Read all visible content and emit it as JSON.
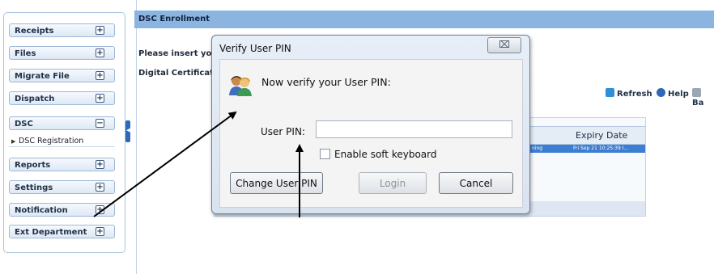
{
  "sidebar": {
    "items": [
      {
        "label": "Receipts",
        "toggle": "+"
      },
      {
        "label": "Files",
        "toggle": "+"
      },
      {
        "label": "Migrate File",
        "toggle": "+"
      },
      {
        "label": "Dispatch",
        "toggle": "+"
      },
      {
        "label": "DSC",
        "toggle": "−"
      },
      {
        "label": "Reports",
        "toggle": "+"
      },
      {
        "label": "Settings",
        "toggle": "+"
      },
      {
        "label": "Notification",
        "toggle": "+"
      },
      {
        "label": "Ext Department",
        "toggle": "+"
      }
    ],
    "sub_items": [
      {
        "label": "DSC Registration"
      }
    ]
  },
  "page": {
    "title": "DSC Enrollment",
    "instruction": "Please insert you",
    "certificate_label": "Digital Certificate"
  },
  "toolbar": {
    "refresh": "Refresh",
    "help": "Help",
    "back": "Ba"
  },
  "grid": {
    "column_expiry": "Expiry Date",
    "row": {
      "status": "ning",
      "expiry": "Fri Sep 21 10:25:39 I..."
    }
  },
  "dialog": {
    "title": "Verify User PIN",
    "close": "⌧",
    "prompt": "Now verify your User PIN:",
    "pin_label": "User PIN:",
    "pin_value": "",
    "soft_keyboard_label": "Enable soft keyboard",
    "buttons": {
      "change_pin": "Change User PIN",
      "login": "Login",
      "cancel": "Cancel"
    }
  },
  "colors": {
    "title_bar": "#8bb4e0",
    "accent": "#2f68b8",
    "selected_row": "#3d7ed1"
  }
}
